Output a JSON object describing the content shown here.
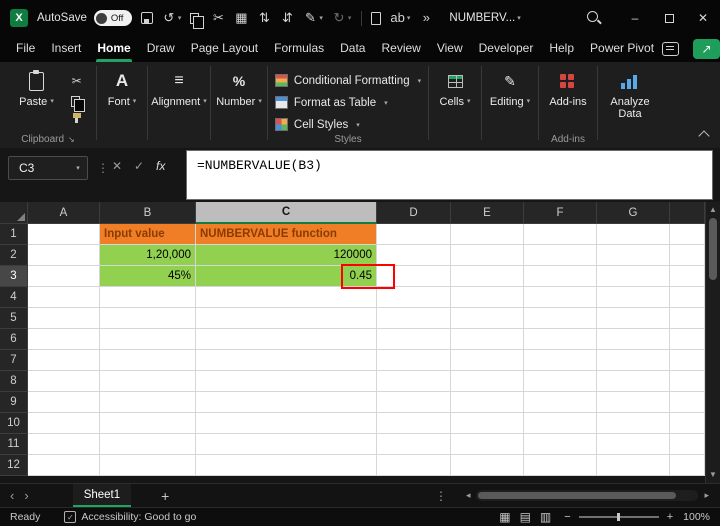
{
  "colors": {
    "accent_green": "#21A366",
    "excel_green": "#107C41",
    "orange_fill": "#F07E26",
    "orange_text": "#8A3B00",
    "green_fill": "#92D050",
    "red_box": "#FF0000"
  },
  "titlebar": {
    "autosave_label": "AutoSave",
    "autosave_state": "Off",
    "workbook_title": "NUMBERV...",
    "qat": [
      {
        "name": "save-icon",
        "css": "css-save"
      },
      {
        "name": "undo-icon",
        "glyph": "↺",
        "chevron": true
      },
      {
        "name": "copy-icon",
        "css": "css-copy"
      },
      {
        "name": "cut-icon",
        "glyph": "✂"
      },
      {
        "name": "workbook-icon",
        "glyph": "▦"
      },
      {
        "name": "sort-ascending-icon",
        "glyph": "⇅"
      },
      {
        "name": "sort-descending-icon",
        "glyph": "⇵"
      },
      {
        "name": "format-painter-icon",
        "glyph": "✎",
        "chevron": true
      },
      {
        "name": "redo-icon",
        "glyph": "↻",
        "chevron": true,
        "dim": true
      },
      {
        "name": "separator"
      },
      {
        "name": "new-document-icon",
        "css": "css-page"
      },
      {
        "name": "translate-icon",
        "glyph": "ab",
        "chevron": true
      },
      {
        "name": "more-commands-icon",
        "glyph": "»"
      }
    ]
  },
  "menubar": {
    "tabs": [
      "File",
      "Insert",
      "Home",
      "Draw",
      "Page Layout",
      "Formulas",
      "Data",
      "Review",
      "View",
      "Developer",
      "Help",
      "Power Pivot"
    ],
    "active_tab": "Home"
  },
  "ribbon": {
    "paste_label": "Paste",
    "clipboard_group": "Clipboard",
    "font_label": "Font",
    "alignment_label": "Alignment",
    "number_label": "Number",
    "styles_items": [
      "Conditional Formatting",
      "Format as Table",
      "Cell Styles"
    ],
    "styles_group": "Styles",
    "cells_label": "Cells",
    "editing_label": "Editing",
    "addins_label": "Add-ins",
    "addins_group": "Add-ins",
    "analyze_label": "Analyze Data"
  },
  "formula_bar": {
    "name_box": "C3",
    "fx_label": "fx",
    "formula": "=NUMBERVALUE(B3)"
  },
  "grid": {
    "columns": [
      "A",
      "B",
      "C",
      "D",
      "E",
      "F",
      "G"
    ],
    "rows": [
      "1",
      "2",
      "3",
      "4",
      "5",
      "6",
      "7",
      "8",
      "9",
      "10",
      "11",
      "12"
    ],
    "selected_column": "C",
    "selected_row": "3",
    "active_cell": "C3",
    "cells": [
      {
        "ref": "B1",
        "text": "Input value",
        "fill": "orange",
        "bold": true,
        "align": "left"
      },
      {
        "ref": "C1",
        "text": "NUMBERVALUE function",
        "fill": "orange",
        "bold": true,
        "align": "left"
      },
      {
        "ref": "B2",
        "text": "1,20,000",
        "fill": "green",
        "align": "right"
      },
      {
        "ref": "C2",
        "text": "120000",
        "fill": "green",
        "align": "right"
      },
      {
        "ref": "B3",
        "text": "45%",
        "fill": "green",
        "align": "right"
      },
      {
        "ref": "C3",
        "text": "0.45",
        "fill": "green",
        "align": "right",
        "annotated": true
      }
    ]
  },
  "sheet_bar": {
    "active_tab": "Sheet1",
    "add_label": "+"
  },
  "status_bar": {
    "ready": "Ready",
    "accessibility": "Accessibility: Good to go",
    "zoom": "100%"
  }
}
